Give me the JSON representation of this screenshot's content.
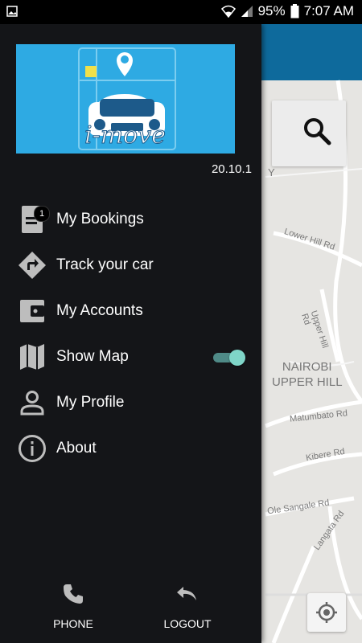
{
  "status_bar": {
    "battery": "95%",
    "time": "7:07 AM"
  },
  "app": {
    "logo_text": "i-move",
    "version": "20.10.1"
  },
  "menu": [
    {
      "label": "My Bookings",
      "icon": "bookings-icon",
      "badge": "1"
    },
    {
      "label": "Track your car",
      "icon": "directions-icon"
    },
    {
      "label": "My Accounts",
      "icon": "wallet-icon"
    },
    {
      "label": "Show Map",
      "icon": "map-icon",
      "toggle_on": true
    },
    {
      "label": "My Profile",
      "icon": "person-icon"
    },
    {
      "label": "About",
      "icon": "info-icon"
    }
  ],
  "bottom_actions": {
    "phone_label": "PHONE",
    "logout_label": "LOGOUT"
  },
  "map": {
    "labels": {
      "lower_hill": "Lower Hill Rd",
      "upper_hill_rd": "Upper Hill Rd",
      "area_line1": "NAIROBI",
      "area_line2": "UPPER HILL",
      "matumbato": "Matumbato Rd",
      "kibere": "Kibere Rd",
      "ole_sangale": "Ole Sangale Rd",
      "langata": "Langata Rd",
      "fragment_y": "Y"
    }
  },
  "colors": {
    "drawer_bg": "#141518",
    "logo_bg": "#2eaae3",
    "toggle_accent": "#7fd5c8",
    "map_topbar": "#0e6a9c"
  }
}
